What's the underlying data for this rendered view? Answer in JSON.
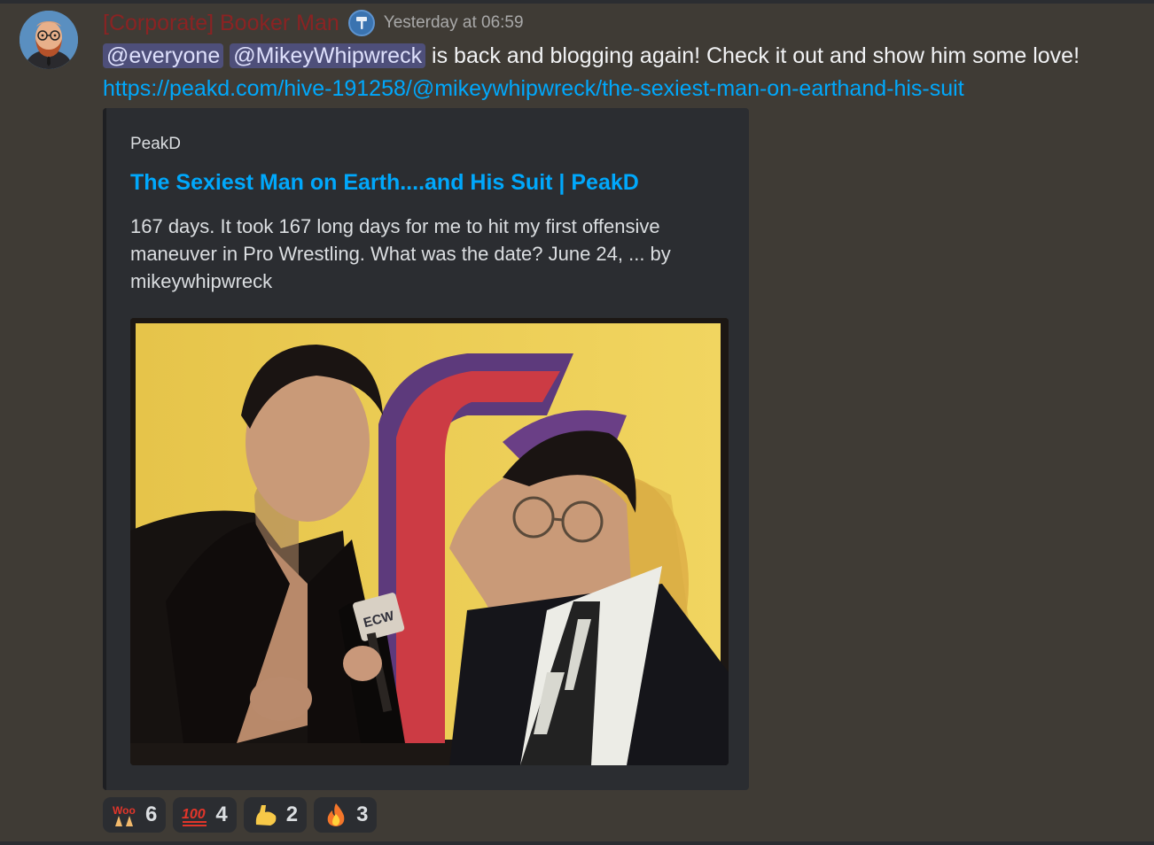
{
  "message": {
    "username": "[Corporate] Booker Man",
    "role_icon": "hammer-icon",
    "timestamp": "Yesterday at 06:59",
    "mention_everyone": "@everyone",
    "mention_user": "@MikeyWhipwreck",
    "text": " is back and blogging again! Check it out and show him some love!",
    "link": "https://peakd.com/hive-191258/@mikeywhipwreck/the-sexiest-man-on-earthand-his-suit"
  },
  "embed": {
    "provider": "PeakD",
    "title": "The Sexiest Man on Earth....and His Suit | PeakD",
    "description": "167 days. It took 167 long days for me to hit my first offensive maneuver in Pro Wrestling. What was the date? June 24, ... by mikeywhipwreck",
    "image_logo_text": "ECW"
  },
  "reactions": [
    {
      "emoji": "woo-emoji",
      "count": "6"
    },
    {
      "emoji": "hundred-points-emoji",
      "count": "4"
    },
    {
      "emoji": "flexed-biceps-emoji",
      "count": "2"
    },
    {
      "emoji": "fire-emoji",
      "count": "3"
    }
  ],
  "colors": {
    "background": "#3f3b35",
    "username": "#8a2323",
    "link": "#00a8fc",
    "mention_bg": "#4e4f7a",
    "embed_bg": "#2b2d31"
  }
}
